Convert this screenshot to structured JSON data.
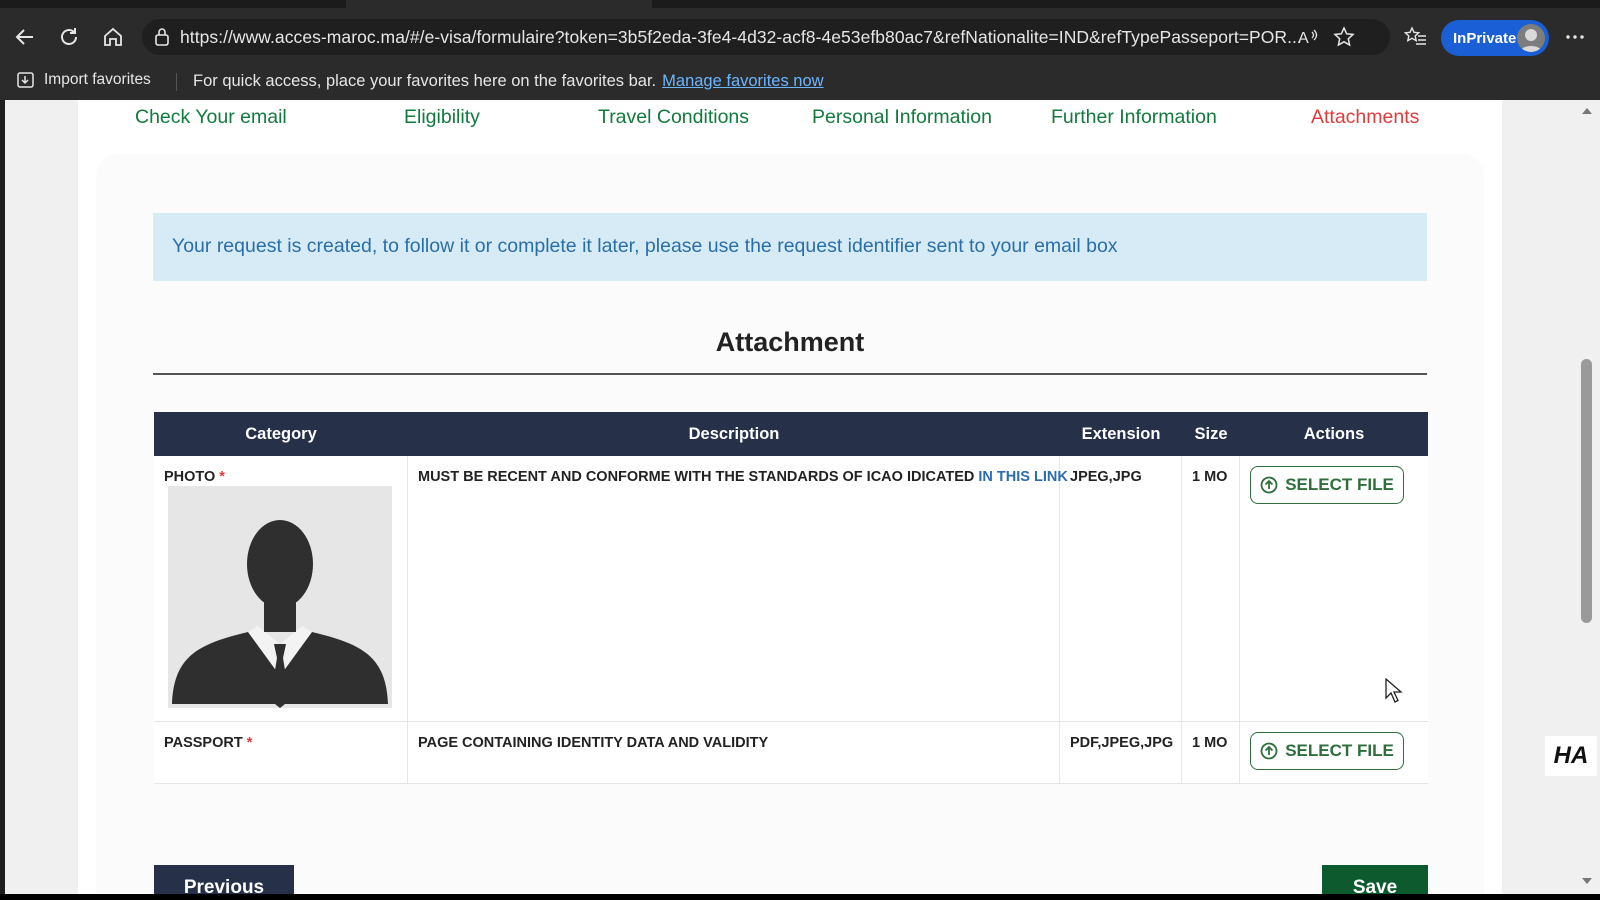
{
  "browser": {
    "url": "https://www.acces-maroc.ma/#/e-visa/formulaire?token=3b5f2eda-3fe4-4d32-acf8-4e53efb80ac7&refNationalite=IND&refTypePasseport=POR...",
    "inprivate_label": "InPrivate",
    "favorites_bar": {
      "import_label": "Import favorites",
      "message": "For quick access, place your favorites here on the favorites bar.",
      "manage_link": "Manage favorites now"
    }
  },
  "steps": [
    {
      "label": "Check Your email"
    },
    {
      "label": "Eligibility"
    },
    {
      "label": "Travel Conditions"
    },
    {
      "label": "Personal Information"
    },
    {
      "label": "Further Information"
    },
    {
      "label": "Attachments"
    }
  ],
  "notice": "Your request is created, to follow it or complete it later, please use the request identifier sent to your email box",
  "section_title": "Attachment",
  "table": {
    "headers": [
      "Category",
      "Description",
      "Extension",
      "Size",
      "Actions"
    ],
    "rows": [
      {
        "category": "PHOTO",
        "required_mark": "*",
        "description": "MUST BE RECENT AND CONFORME WITH THE STANDARDS OF ICAO IDICATED",
        "description_link": "IN THIS LINK",
        "extension": "JPEG,JPG",
        "size": "1 MO",
        "action_label": "SELECT FILE"
      },
      {
        "category": "PASSPORT",
        "required_mark": "*",
        "description": "PAGE CONTAINING IDENTITY DATA AND VALIDITY",
        "extension": "PDF,JPEG,JPG",
        "size": "1 MO",
        "action_label": "SELECT FILE"
      }
    ]
  },
  "buttons": {
    "previous": "Previous",
    "save": "Save"
  },
  "watermark": "HA",
  "colors": {
    "step_done": "#127a3d",
    "step_active": "#e03b3b",
    "table_header": "#263049",
    "save_button": "#0e5a2f",
    "notice_bg": "#d7ebf6"
  }
}
